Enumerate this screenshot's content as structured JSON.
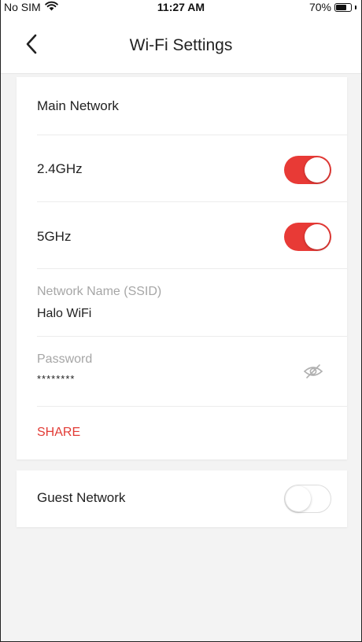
{
  "status_bar": {
    "carrier": "No SIM",
    "time": "11:27 AM",
    "battery_percent": "70%",
    "battery_level": 0.7
  },
  "nav": {
    "title": "Wi-Fi Settings",
    "back_icon": "chevron-left-icon"
  },
  "main_network": {
    "section_title": "Main Network",
    "band_24": {
      "label": "2.4GHz",
      "enabled": true
    },
    "band_5": {
      "label": "5GHz",
      "enabled": true
    },
    "ssid": {
      "label": "Network Name (SSID)",
      "value": "Halo WiFi"
    },
    "password": {
      "label": "Password",
      "value": "********",
      "reveal_icon": "eye-off-icon"
    },
    "share_label": "SHARE"
  },
  "guest_network": {
    "label": "Guest Network",
    "enabled": false
  },
  "colors": {
    "accent": "#e83a36",
    "background": "#f3f3f3",
    "card": "#ffffff"
  }
}
